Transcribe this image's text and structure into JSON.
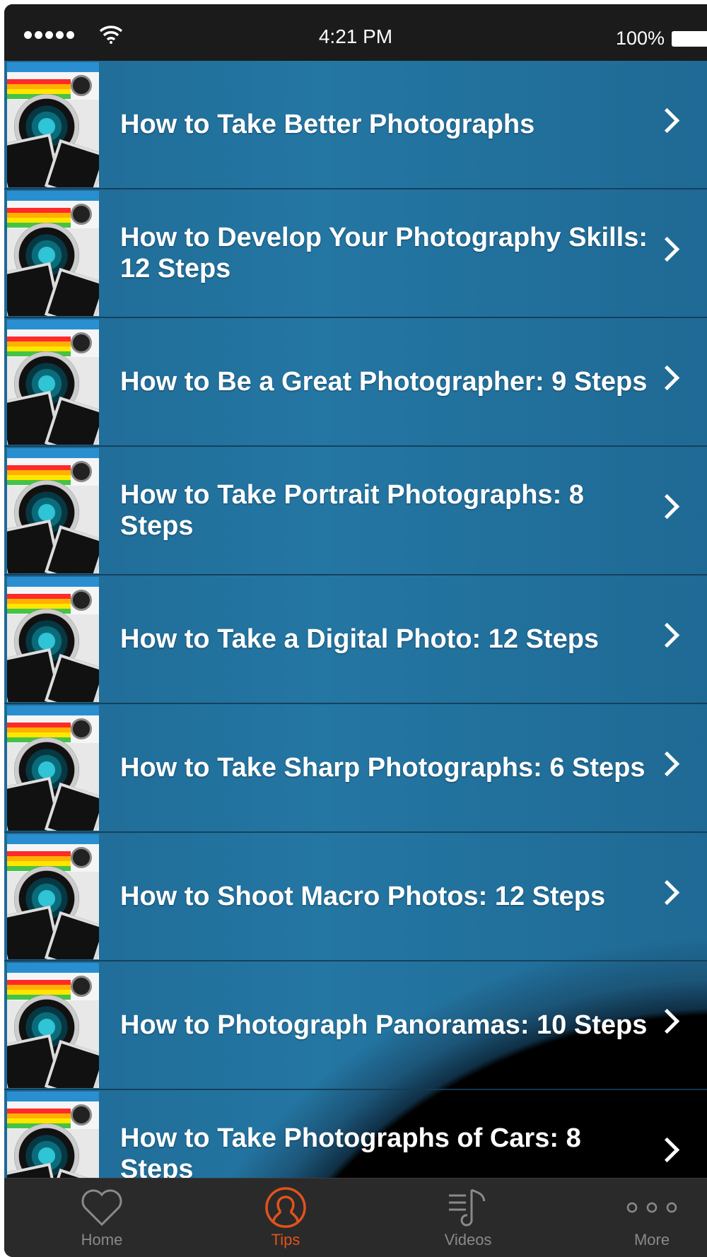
{
  "status_bar": {
    "time": "4:21 PM",
    "battery": "100%"
  },
  "list": {
    "items": [
      {
        "title": "How to Take Better Photographs"
      },
      {
        "title": "How to Develop Your Photography Skills: 12 Steps"
      },
      {
        "title": "How to Be a Great Photographer: 9 Steps"
      },
      {
        "title": "How to Take Portrait Photographs: 8 Steps"
      },
      {
        "title": "How to Take a Digital Photo: 12 Steps"
      },
      {
        "title": "How to Take Sharp Photographs: 6 Steps"
      },
      {
        "title": "How to Shoot Macro Photos: 12 Steps"
      },
      {
        "title": "How to Photograph Panoramas: 10 Steps"
      },
      {
        "title": "How to Take Photographs of Cars: 8 Steps"
      }
    ]
  },
  "tab_bar": {
    "tabs": [
      {
        "label": "Home",
        "icon": "heart-icon",
        "active": false
      },
      {
        "label": "Tips",
        "icon": "person-circle-icon",
        "active": true
      },
      {
        "label": "Videos",
        "icon": "music-list-icon",
        "active": false
      },
      {
        "label": "More",
        "icon": "more-dots-icon",
        "active": false
      }
    ],
    "active_color": "#e2521c",
    "inactive_color": "#8a8a8a"
  }
}
